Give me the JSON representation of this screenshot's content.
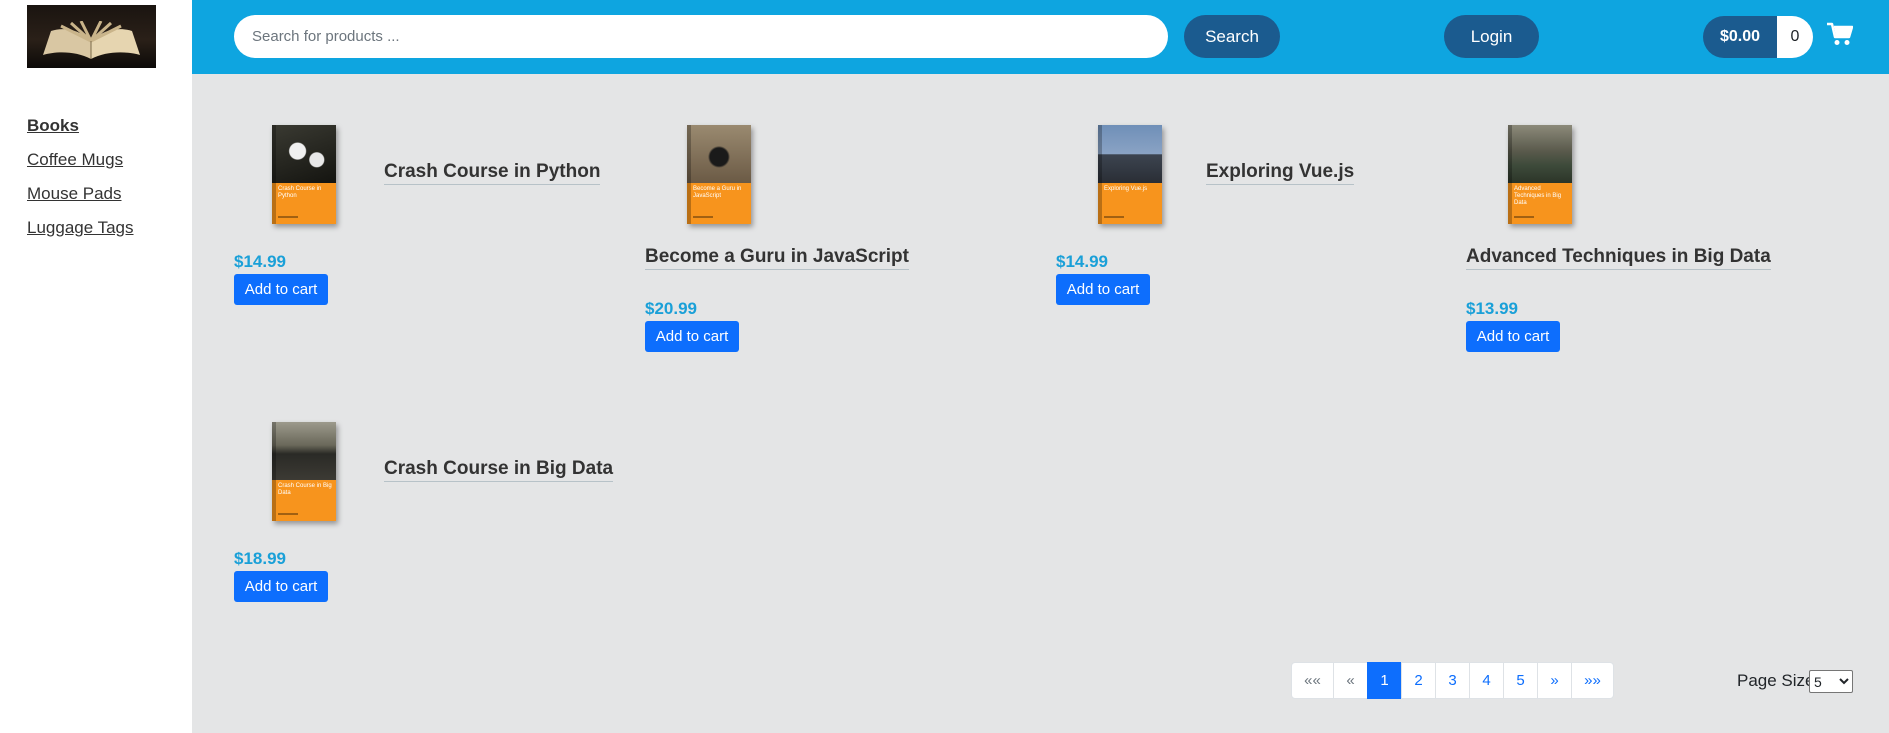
{
  "header": {
    "search_placeholder": "Search for products ...",
    "search_label": "Search",
    "login_label": "Login",
    "cart_total": "$0.00",
    "cart_count": "0"
  },
  "sidebar": {
    "items": [
      {
        "label": "Books",
        "active": true
      },
      {
        "label": "Coffee Mugs",
        "active": false
      },
      {
        "label": "Mouse Pads",
        "active": false
      },
      {
        "label": "Luggage Tags",
        "active": false
      }
    ]
  },
  "products": [
    {
      "title": "Crash Course in Python",
      "price": "$14.99",
      "button": "Add to cart",
      "cover_text": "Crash Course in Python"
    },
    {
      "title": "Become a Guru in JavaScript",
      "price": "$20.99",
      "button": "Add to cart",
      "cover_text": "Become a Guru in JavaScript"
    },
    {
      "title": "Exploring Vue.js",
      "price": "$14.99",
      "button": "Add to cart",
      "cover_text": "Exploring Vue.js"
    },
    {
      "title": "Advanced Techniques in Big Data",
      "price": "$13.99",
      "button": "Add to cart",
      "cover_text": "Advanced Techniques in Big Data"
    },
    {
      "title": "Crash Course in Big Data",
      "price": "$18.99",
      "button": "Add to cart",
      "cover_text": "Crash Course in Big Data"
    }
  ],
  "pagination": {
    "first": "««",
    "prev": "«",
    "pages": [
      "1",
      "2",
      "3",
      "4",
      "5"
    ],
    "current": "1",
    "next": "»",
    "last": "»»"
  },
  "page_size": {
    "label": "Page Size",
    "value": "5"
  },
  "colors": {
    "header_bg": "#0ea5e0",
    "button_dark": "#1b5b8f",
    "primary": "#0d6efd",
    "price": "#1aa0d8",
    "cover_orange": "#f7941d",
    "main_bg": "#e4e5e6"
  }
}
